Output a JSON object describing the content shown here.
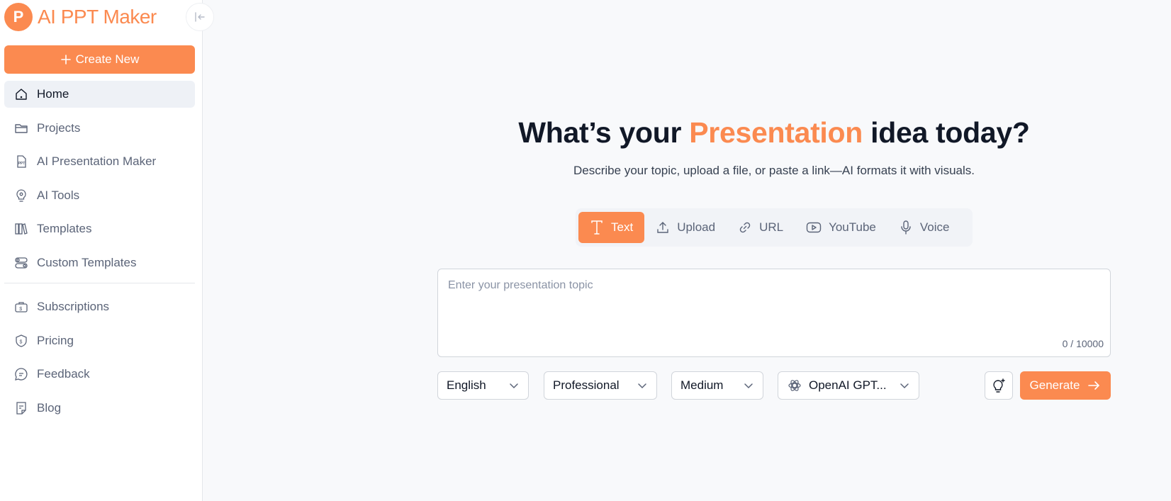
{
  "brand": {
    "logo_letter": "P",
    "name": "AI PPT Maker"
  },
  "sidebar": {
    "create_label": "Create New",
    "items": [
      {
        "label": "Home",
        "icon": "home-icon",
        "active": true
      },
      {
        "label": "Projects",
        "icon": "folder-icon"
      },
      {
        "label": "AI Presentation Maker",
        "icon": "ppt-icon"
      },
      {
        "label": "AI Tools",
        "icon": "bulb-gear-icon"
      },
      {
        "label": "Templates",
        "icon": "books-icon"
      },
      {
        "label": "Custom Templates",
        "icon": "toggles-icon"
      }
    ],
    "items_secondary": [
      {
        "label": "Subscriptions",
        "icon": "briefcase-dollar-icon"
      },
      {
        "label": "Pricing",
        "icon": "shield-dollar-icon"
      },
      {
        "label": "Feedback",
        "icon": "chat-icon"
      },
      {
        "label": "Blog",
        "icon": "note-icon"
      }
    ]
  },
  "hero": {
    "title_before": "What’s your",
    "title_accent": "Presentation",
    "title_after": "idea today?",
    "subtitle": "Describe your topic, upload a file, or paste a link—AI formats it with visuals."
  },
  "tabs": [
    {
      "label": "Text",
      "icon": "text-cursor-icon",
      "active": true
    },
    {
      "label": "Upload",
      "icon": "upload-icon"
    },
    {
      "label": "URL",
      "icon": "link-icon"
    },
    {
      "label": "YouTube",
      "icon": "youtube-icon"
    },
    {
      "label": "Voice",
      "icon": "microphone-icon"
    }
  ],
  "input": {
    "placeholder": "Enter your presentation topic",
    "value": "",
    "counter": "0 / 10000"
  },
  "options": {
    "language": "English",
    "tone": "Professional",
    "length": "Medium",
    "model": "OpenAI GPT..."
  },
  "generate_label": "Generate",
  "colors": {
    "accent": "#fb8a50",
    "text": "#111827",
    "muted": "#5b6478"
  }
}
